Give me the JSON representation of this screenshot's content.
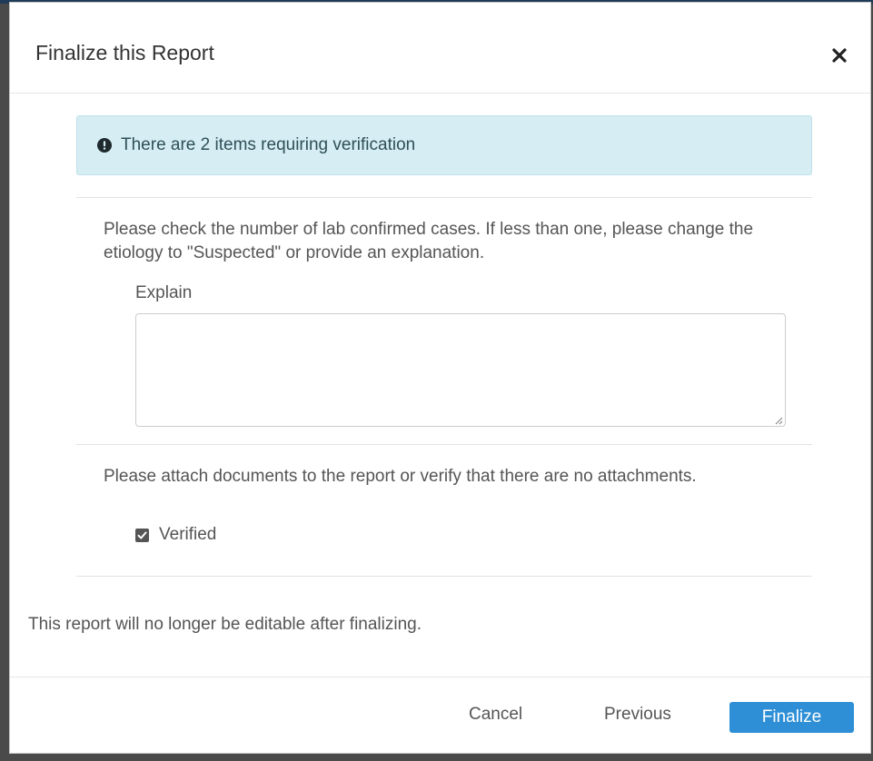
{
  "modal": {
    "title": "Finalize this Report",
    "close_icon": "close-icon"
  },
  "alert": {
    "icon": "exclamation-circle-icon",
    "text": "There are 2 items requiring verification",
    "colors": {
      "background": "#d5edf3",
      "text": "#2f4f57"
    }
  },
  "verification_items": [
    {
      "message": "Please check the number of lab confirmed cases. If less than one, please change the etiology to \"Suspected\" or provide an explanation.",
      "explain_label": "Explain",
      "explain_value": ""
    },
    {
      "message": "Please attach documents to the report or verify that there are no attachments.",
      "checkbox_label": "Verified",
      "checkbox_checked": true
    }
  ],
  "note": "This report will no longer be editable after finalizing.",
  "footer": {
    "cancel_label": "Cancel",
    "previous_label": "Previous",
    "finalize_label": "Finalize",
    "primary_color": "#2e8fd6"
  }
}
